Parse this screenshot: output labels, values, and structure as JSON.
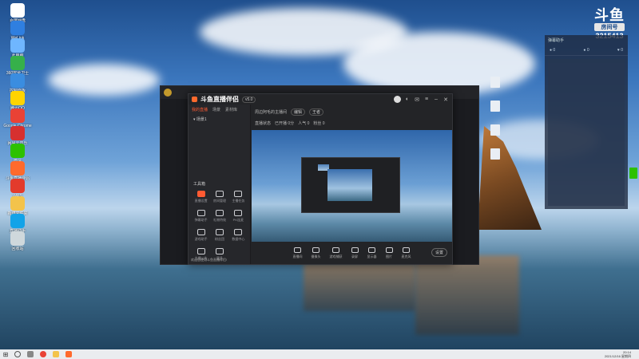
{
  "desktop": {
    "icons": [
      {
        "label": "百度网盘",
        "color": "#ffffff"
      },
      {
        "label": "WeLink",
        "color": "#2f7fe0"
      },
      {
        "label": "此电脑",
        "color": "#6fb6ff"
      },
      {
        "label": "360安全卫士",
        "color": "#36b04a"
      },
      {
        "label": "控制面板",
        "color": "#3a8de0"
      },
      {
        "label": "腾讯QQ",
        "color": "#ffd400"
      },
      {
        "label": "Google Chrome",
        "color": "#e94235"
      },
      {
        "label": "网易云音乐",
        "color": "#d63030"
      },
      {
        "label": "微信",
        "color": "#2dc100"
      },
      {
        "label": "斗鱼直播伴侣",
        "color": "#ff6a2d"
      },
      {
        "label": "WPS",
        "color": "#e33b2c"
      },
      {
        "label": "新建文件夹",
        "color": "#f3c34b"
      },
      {
        "label": "直播助手",
        "color": "#12a3e8"
      },
      {
        "label": "回收站",
        "color": "#cfd8dc"
      }
    ]
  },
  "douyu": {
    "logo": "斗鱼",
    "tag": "房间号",
    "room": "3215413"
  },
  "danmu_panel": {
    "header": "弹幕助手",
    "stats": [
      "● 0",
      "● 0",
      "♥ 0"
    ]
  },
  "app": {
    "brand": "斗鱼直播伴侣",
    "version": "v5.0",
    "left_tabs": [
      "我的直播",
      "场景",
      "素材库"
    ],
    "scene": "▾ 场景1",
    "tools_title": "工具箱",
    "tools": [
      "直播设置",
      "房间管理",
      "主播任务",
      "弹幕助手",
      "礼物特效",
      "PK连麦",
      "游戏助手",
      "粉丝团",
      "数据中心",
      "主播公告",
      "更多"
    ],
    "notice": "欢迎您使用斗鱼直播伴侣!",
    "room_title": "周边阿毛的主播间",
    "edit_label": "编辑",
    "category": "王者",
    "info_items": [
      "直播状态",
      "已开播 0分",
      "人气 0",
      "粉丝 0"
    ],
    "bottom_actions": [
      "直播间",
      "摄像头",
      "游戏捕获",
      "录屏",
      "显示器",
      "图片",
      "麦克风"
    ],
    "settings_label": "设置"
  },
  "taskbar": {
    "time": "20:14",
    "date": "2021/12/16 星期四"
  }
}
